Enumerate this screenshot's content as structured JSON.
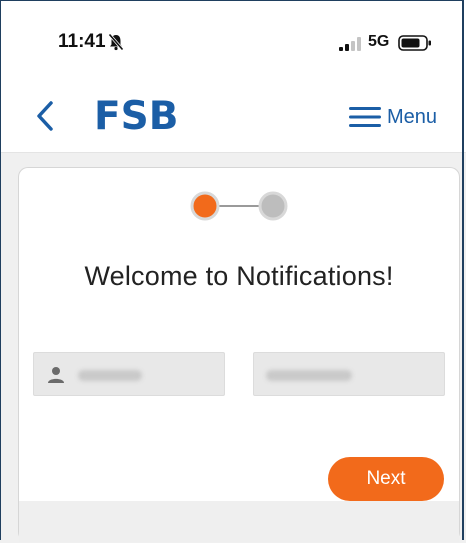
{
  "status_bar": {
    "time": "11:41",
    "network": "5G",
    "icons": [
      "bell-muted-icon",
      "signal-icon",
      "battery-icon"
    ]
  },
  "header": {
    "logo_text": "FSB",
    "menu_label": "Menu",
    "icons": [
      "back-chevron-icon",
      "hamburger-icon"
    ]
  },
  "stepper": {
    "steps": 2,
    "current_step": 1
  },
  "main": {
    "title": "Welcome to Notifications!",
    "fields": [
      {
        "name": "first-field",
        "icon": "person-icon"
      },
      {
        "name": "second-field"
      }
    ],
    "next_label": "Next"
  },
  "colors": {
    "brand_blue": "#1b5ea6",
    "accent_orange": "#f26a1b",
    "step_inactive": "#bdbdbd",
    "field_bg": "#e8e8e8"
  }
}
